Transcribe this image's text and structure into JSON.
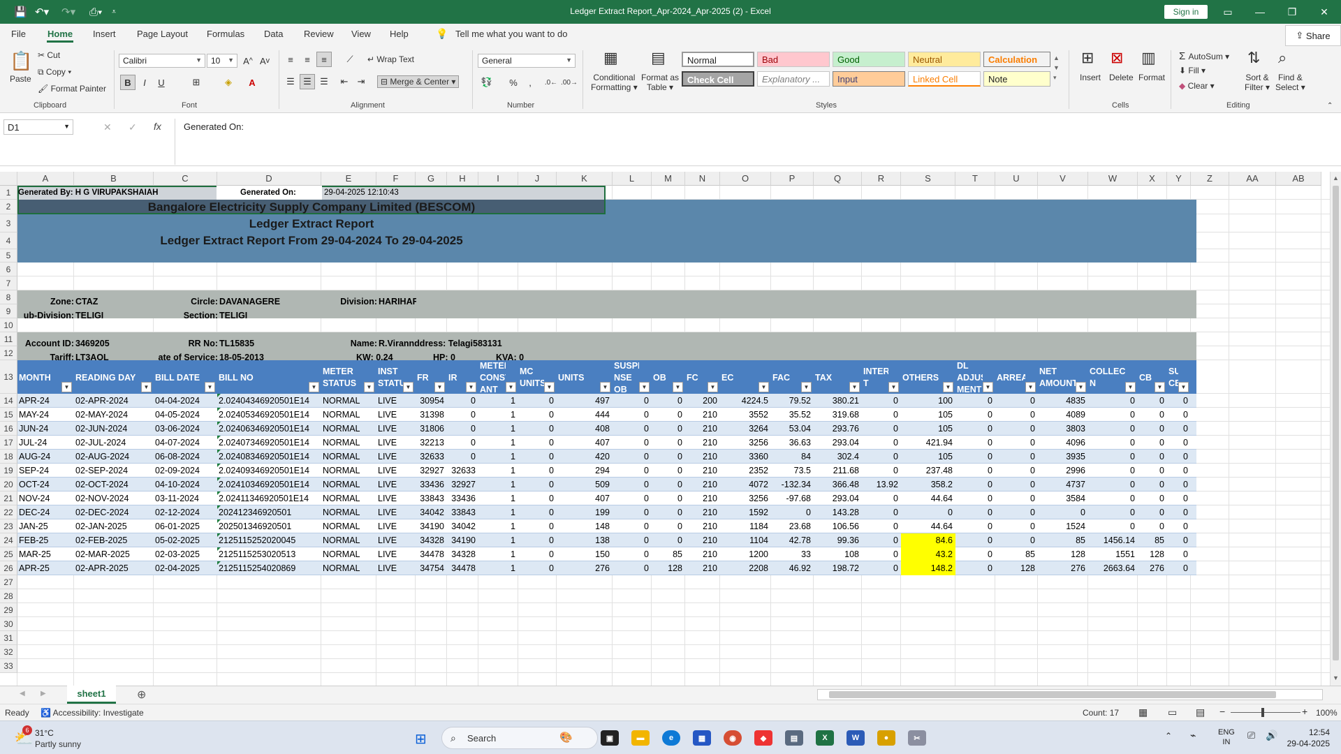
{
  "window": {
    "title": "Ledger Extract Report_Apr-2024_Apr-2025 (2)  -  Excel",
    "sign_in": "Sign in"
  },
  "menu": {
    "tabs": [
      "File",
      "Home",
      "Insert",
      "Page Layout",
      "Formulas",
      "Data",
      "Review",
      "View",
      "Help"
    ],
    "active": "Home",
    "tell_me": "Tell me what you want to do",
    "share": "Share"
  },
  "ribbon": {
    "clipboard": {
      "paste": "Paste",
      "cut": "Cut",
      "copy": "Copy",
      "format_painter": "Format Painter",
      "label": "Clipboard"
    },
    "font": {
      "name": "Calibri",
      "size": "10",
      "label": "Font"
    },
    "alignment": {
      "wrap_text": "Wrap Text",
      "merge_center": "Merge & Center",
      "label": "Alignment"
    },
    "number": {
      "format": "General",
      "label": "Number"
    },
    "styles": {
      "conditional": "Conditional",
      "conditional2": "Formatting",
      "format_as": "Format as",
      "format_as2": "Table",
      "label": "Styles",
      "boxes": [
        "Normal",
        "Bad",
        "Good",
        "Neutral",
        "Calculation",
        "Check Cell",
        "Explanatory ...",
        "Input",
        "Linked Cell",
        "Note"
      ]
    },
    "cells": {
      "insert": "Insert",
      "delete": "Delete",
      "format": "Format",
      "label": "Cells"
    },
    "editing": {
      "autosum": "AutoSum",
      "fill": "Fill",
      "clear": "Clear",
      "sort": "Sort &",
      "sort2": "Filter",
      "find": "Find &",
      "find2": "Select",
      "label": "Editing"
    }
  },
  "formula_bar": {
    "name_box": "D1",
    "content": "Generated On:"
  },
  "columns": [
    "A",
    "B",
    "C",
    "D",
    "E",
    "F",
    "G",
    "H",
    "I",
    "J",
    "K",
    "L",
    "M",
    "N",
    "O",
    "P",
    "Q",
    "R",
    "S",
    "T",
    "U",
    "V",
    "W",
    "X",
    "Y",
    "Z",
    "AA",
    "AB"
  ],
  "sheet": {
    "r1": {
      "generated_by": "Generated By: H G VIRUPAKSHAIAH",
      "generated_on_label": "Generated On:",
      "generated_on": "29-04-2025 12:10:43"
    },
    "r2": "Bangalore Electricity Supply Company Limited (BESCOM)",
    "r3": "Ledger Extract Report",
    "r4": "Ledger Extract Report From 29-04-2024 To 29-04-2025",
    "r8": {
      "zone_label": "Zone:",
      "zone": "CTAZ",
      "circle_label": "Circle:",
      "circle": "DAVANAGERE",
      "division_label": "Division:",
      "division": "HARIHAF"
    },
    "r9": {
      "subdiv_label": "ub-Division:",
      "subdiv": "TELIGI",
      "section_label": "Section:",
      "section": "TELIGI"
    },
    "r11": {
      "account_label": "Account ID:",
      "account": "3469205",
      "rr_label": "RR No:",
      "rr": "TL15835",
      "name_label": "Name:",
      "name": "R.Virannddress: Telagi583131"
    },
    "r12": {
      "tariff_label": "Tariff:",
      "tariff": "LT3AOL",
      "dos_label": "ate of Service:",
      "dos": "18-05-2013",
      "kw": "KW: 0.24",
      "hp": "HP: 0",
      "kva": "KVA: 0"
    },
    "headers": [
      "MONTH",
      "READING DAY",
      "BILL DATE",
      "BILL NO",
      "METER STATUS",
      "INST STATUS",
      "FR",
      "IR",
      "METER CONST ANT",
      "MC UNITS",
      "UNITS",
      "SUSPE NSE OB",
      "OB",
      "FC",
      "EC",
      "FAC",
      "TAX",
      "INTERES T",
      "OTHERS",
      "DL ADJUST MENT",
      "ARREARS",
      "NET AMOUNT",
      "COLLECTIO N",
      "CB",
      "SUS CB"
    ],
    "rows": [
      [
        "APR-24",
        "02-APR-2024",
        "04-04-2024",
        "2.02404346920501E14",
        "NORMAL",
        "LIVE",
        "30954",
        "0",
        "1",
        "0",
        "497",
        "0",
        "0",
        "200",
        "4224.5",
        "79.52",
        "380.21",
        "0",
        "100",
        "0",
        "0",
        "4835",
        "0",
        "0",
        "0"
      ],
      [
        "MAY-24",
        "02-MAY-2024",
        "04-05-2024",
        "2.02405346920501E14",
        "NORMAL",
        "LIVE",
        "31398",
        "0",
        "1",
        "0",
        "444",
        "0",
        "0",
        "210",
        "3552",
        "35.52",
        "319.68",
        "0",
        "105",
        "0",
        "0",
        "4089",
        "0",
        "0",
        "0"
      ],
      [
        "JUN-24",
        "02-JUN-2024",
        "03-06-2024",
        "2.02406346920501E14",
        "NORMAL",
        "LIVE",
        "31806",
        "0",
        "1",
        "0",
        "408",
        "0",
        "0",
        "210",
        "3264",
        "53.04",
        "293.76",
        "0",
        "105",
        "0",
        "0",
        "3803",
        "0",
        "0",
        "0"
      ],
      [
        "JUL-24",
        "02-JUL-2024",
        "04-07-2024",
        "2.02407346920501E14",
        "NORMAL",
        "LIVE",
        "32213",
        "0",
        "1",
        "0",
        "407",
        "0",
        "0",
        "210",
        "3256",
        "36.63",
        "293.04",
        "0",
        "421.94",
        "0",
        "0",
        "4096",
        "0",
        "0",
        "0"
      ],
      [
        "AUG-24",
        "02-AUG-2024",
        "06-08-2024",
        "2.02408346920501E14",
        "NORMAL",
        "LIVE",
        "32633",
        "0",
        "1",
        "0",
        "420",
        "0",
        "0",
        "210",
        "3360",
        "84",
        "302.4",
        "0",
        "105",
        "0",
        "0",
        "3935",
        "0",
        "0",
        "0"
      ],
      [
        "SEP-24",
        "02-SEP-2024",
        "02-09-2024",
        "2.02409346920501E14",
        "NORMAL",
        "LIVE",
        "32927",
        "32633",
        "1",
        "0",
        "294",
        "0",
        "0",
        "210",
        "2352",
        "73.5",
        "211.68",
        "0",
        "237.48",
        "0",
        "0",
        "2996",
        "0",
        "0",
        "0"
      ],
      [
        "OCT-24",
        "02-OCT-2024",
        "04-10-2024",
        "2.02410346920501E14",
        "NORMAL",
        "LIVE",
        "33436",
        "32927",
        "1",
        "0",
        "509",
        "0",
        "0",
        "210",
        "4072",
        "-132.34",
        "366.48",
        "13.92",
        "358.2",
        "0",
        "0",
        "4737",
        "0",
        "0",
        "0"
      ],
      [
        "NOV-24",
        "02-NOV-2024",
        "03-11-2024",
        "2.02411346920501E14",
        "NORMAL",
        "LIVE",
        "33843",
        "33436",
        "1",
        "0",
        "407",
        "0",
        "0",
        "210",
        "3256",
        "-97.68",
        "293.04",
        "0",
        "44.64",
        "0",
        "0",
        "3584",
        "0",
        "0",
        "0"
      ],
      [
        "DEC-24",
        "02-DEC-2024",
        "02-12-2024",
        "202412346920501",
        "NORMAL",
        "LIVE",
        "34042",
        "33843",
        "1",
        "0",
        "199",
        "0",
        "0",
        "210",
        "1592",
        "0",
        "143.28",
        "0",
        "0",
        "0",
        "0",
        "0",
        "0",
        "0",
        "0"
      ],
      [
        "JAN-25",
        "02-JAN-2025",
        "06-01-2025",
        "202501346920501",
        "NORMAL",
        "LIVE",
        "34190",
        "34042",
        "1",
        "0",
        "148",
        "0",
        "0",
        "210",
        "1184",
        "23.68",
        "106.56",
        "0",
        "44.64",
        "0",
        "0",
        "1524",
        "0",
        "0",
        "0"
      ],
      [
        "FEB-25",
        "02-FEB-2025",
        "05-02-2025",
        "2125115252020045",
        "NORMAL",
        "LIVE",
        "34328",
        "34190",
        "1",
        "0",
        "138",
        "0",
        "0",
        "210",
        "1104",
        "42.78",
        "99.36",
        "0",
        "84.6",
        "0",
        "0",
        "85",
        "1456.14",
        "85",
        "0"
      ],
      [
        "MAR-25",
        "02-MAR-2025",
        "02-03-2025",
        "2125115253020513",
        "NORMAL",
        "LIVE",
        "34478",
        "34328",
        "1",
        "0",
        "150",
        "0",
        "85",
        "210",
        "1200",
        "33",
        "108",
        "0",
        "43.2",
        "0",
        "85",
        "128",
        "1551",
        "128",
        "0"
      ],
      [
        "APR-25",
        "02-APR-2025",
        "02-04-2025",
        "2125115254020869",
        "NORMAL",
        "LIVE",
        "34754",
        "34478",
        "1",
        "0",
        "276",
        "0",
        "128",
        "210",
        "2208",
        "46.92",
        "198.72",
        "0",
        "148.2",
        "0",
        "128",
        "276",
        "2663.64",
        "276",
        "0"
      ]
    ]
  },
  "sheet_tab": "sheet1",
  "status": {
    "ready": "Ready",
    "accessibility": "Accessibility: Investigate",
    "count": "Count: 17",
    "zoom": "100%"
  },
  "taskbar": {
    "weather_temp": "31°C",
    "weather_desc": "Partly sunny",
    "search": "Search",
    "lang1": "ENG",
    "lang2": "IN",
    "time": "12:54",
    "date": "29-04-2025",
    "badge": "6"
  },
  "colors": {
    "excel_green": "#217346",
    "band": "#5b87ab",
    "header": "#4a7fc1",
    "gray_band": "#b0b7b3",
    "highlight": "#ffff00"
  }
}
